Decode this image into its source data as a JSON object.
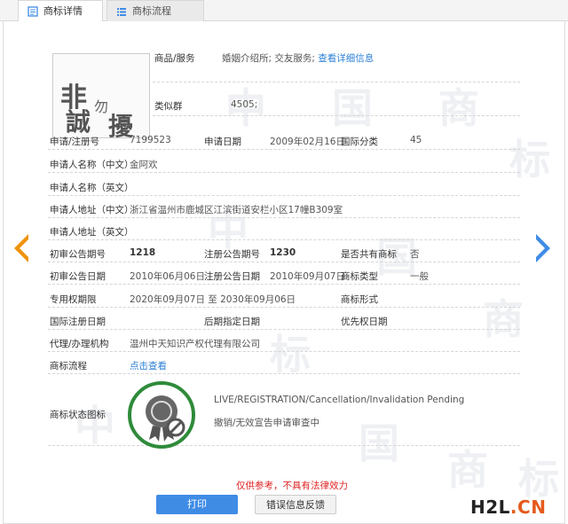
{
  "tabs": [
    {
      "label": "商标详情",
      "active": true
    },
    {
      "label": "商标流程",
      "active": false
    }
  ],
  "logo_text": {
    "c1": "非",
    "c2": "誠",
    "c3": "勿",
    "c4": "擾"
  },
  "watermark_chars": [
    "中",
    "国",
    "商",
    "标"
  ],
  "goods_services": {
    "label": "商品/服务",
    "value": "婚姻介绍所; 交友服务;",
    "link": "查看详细信息"
  },
  "similar_group": {
    "label": "类似群",
    "value": "4505;"
  },
  "fields": {
    "reg_no": {
      "label": "申请/注册号",
      "value": "7199523"
    },
    "apply_date": {
      "label": "申请日期",
      "value": "2009年02月16日"
    },
    "intl_class": {
      "label": "国际分类",
      "value": "45"
    },
    "applicant_cn": {
      "label": "申请人名称（中文）",
      "value": "金阿欢"
    },
    "applicant_en": {
      "label": "申请人名称（英文）",
      "value": ""
    },
    "address_cn": {
      "label": "申请人地址（中文）",
      "value": "浙江省温州市鹿城区江滨街道安栏小区17幢B309室"
    },
    "address_en": {
      "label": "申请人地址（英文）",
      "value": ""
    },
    "prelim_no": {
      "label": "初审公告期号",
      "value": "1218"
    },
    "reg_pub_no": {
      "label": "注册公告期号",
      "value": "1230"
    },
    "shared": {
      "label": "是否共有商标",
      "value": "否"
    },
    "prelim_date": {
      "label": "初审公告日期",
      "value": "2010年06月06日"
    },
    "reg_pub_date": {
      "label": "注册公告日期",
      "value": "2010年09月07日"
    },
    "tm_type": {
      "label": "商标类型",
      "value": "一般"
    },
    "exclusive_period": {
      "label": "专用权期限",
      "value": "2020年09月07日 至 2030年09月06日"
    },
    "tm_form": {
      "label": "商标形式",
      "value": ""
    },
    "intl_reg_date": {
      "label": "国际注册日期",
      "value": ""
    },
    "later_date": {
      "label": "后期指定日期",
      "value": ""
    },
    "priority_date": {
      "label": "优先权日期",
      "value": ""
    },
    "agent": {
      "label": "代理/办理机构",
      "value": "温州中天知识产权代理有限公司"
    },
    "flow": {
      "label": "商标流程",
      "value": "点击查看"
    },
    "status_icon": {
      "label": "商标状态图标",
      "value": ""
    }
  },
  "status": {
    "en": "LIVE/REGISTRATION/Cancellation/Invalidation Pending",
    "cn": "撤销/无效宣告申请审查中"
  },
  "disclaimer": "仅供参考，不具有法律效力",
  "buttons": {
    "print": "打印",
    "feedback": "错误信息反馈"
  },
  "site_logo": {
    "a": "H2L",
    "b": ".",
    "c": "CN"
  },
  "colors": {
    "link": "#2b7fd6",
    "accent_orange": "#f0920a",
    "accent_blue": "#3f8ce5",
    "status_green": "#2e8b3a",
    "warning_red": "#e02020"
  }
}
